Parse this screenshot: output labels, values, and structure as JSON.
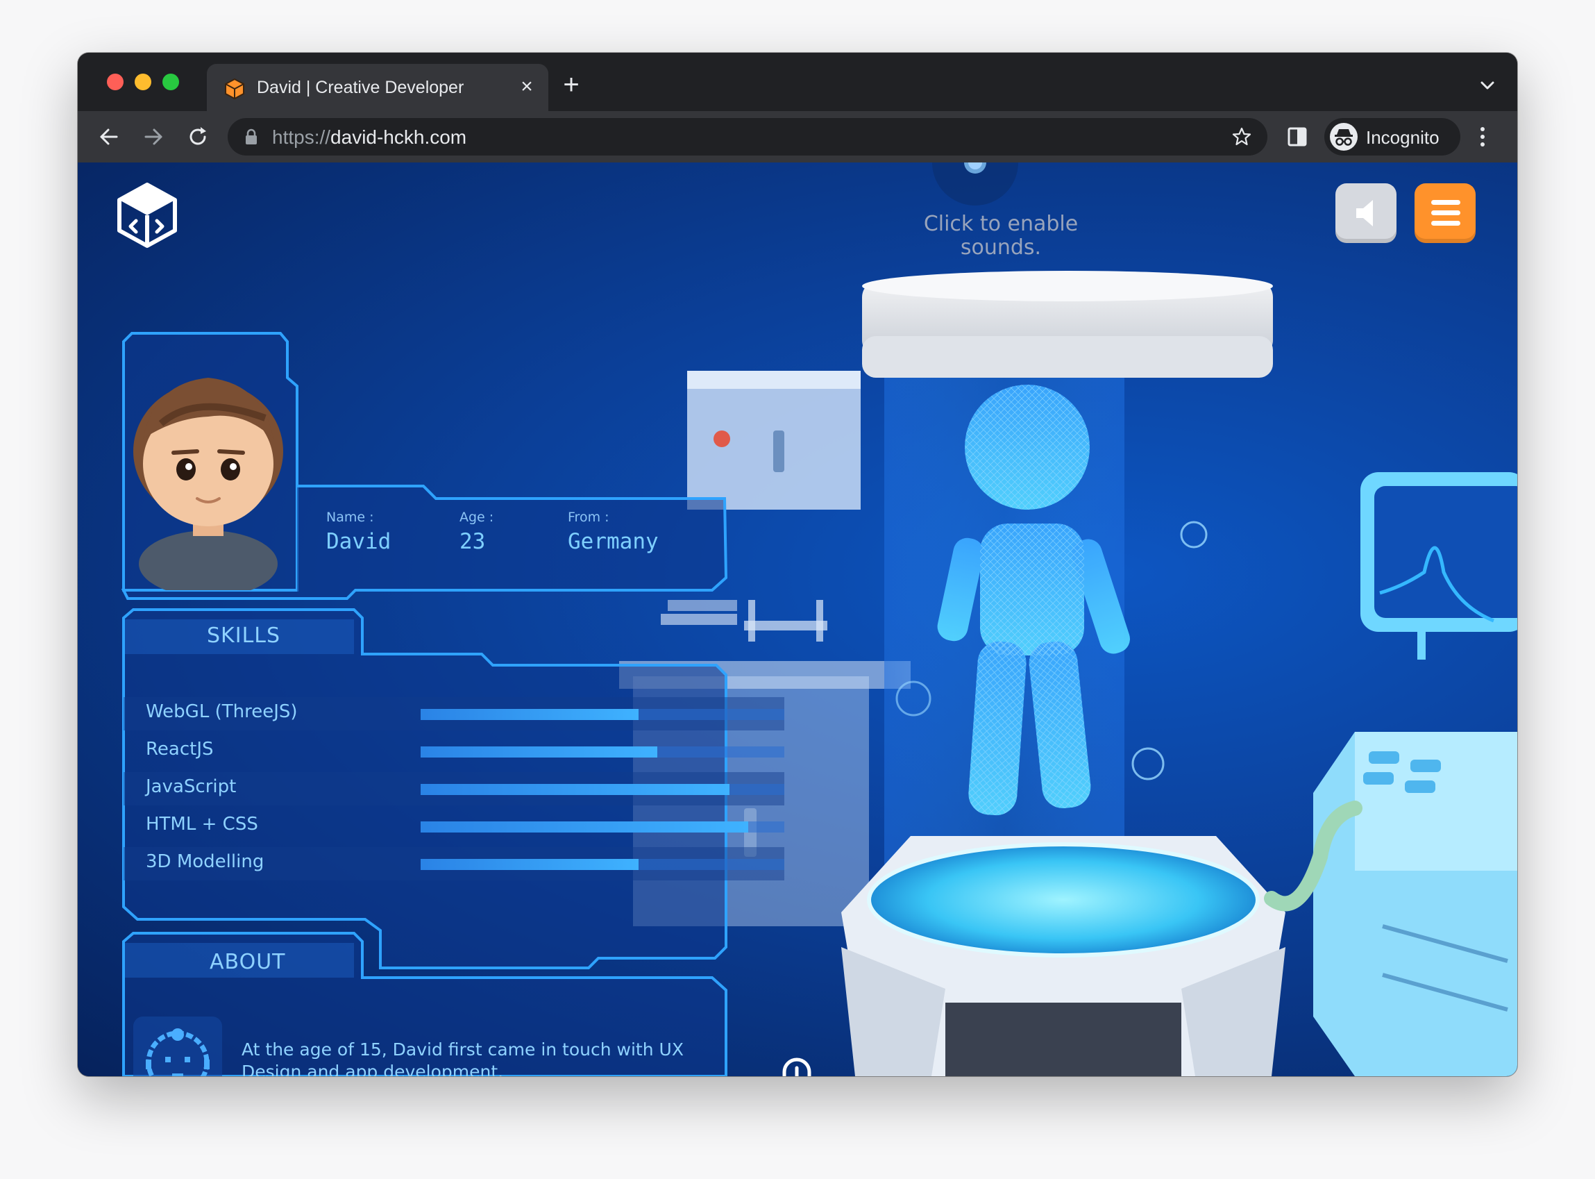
{
  "browser": {
    "tab_title": "David | Creative Developer",
    "url_scheme": "https://",
    "url_host": "david-hckh.com",
    "incognito_label": "Incognito",
    "icons": [
      "back-arrow-icon",
      "forward-arrow-icon",
      "reload-icon",
      "lock-icon",
      "star-icon",
      "side-panel-icon",
      "incognito-icon",
      "more-vert-icon",
      "close-icon",
      "plus-icon",
      "chevron-down-icon"
    ]
  },
  "site": {
    "sound_hint_line1": "Click to enable",
    "sound_hint_line2": "sounds.",
    "colors": {
      "accent": "#ff922b",
      "panel_border": "#2fa3ff",
      "text": "#8fd2ff",
      "bg": "#0b3f98"
    }
  },
  "profile": {
    "name_label": "Name :",
    "name_value": "David",
    "age_label": "Age :",
    "age_value": "23",
    "from_label": "From :",
    "from_value": "Germany"
  },
  "skills": {
    "title": "SKILLS",
    "items": [
      {
        "label": "WebGL (ThreeJS)",
        "level": 0.6
      },
      {
        "label": "ReactJS",
        "level": 0.65
      },
      {
        "label": "JavaScript",
        "level": 0.85
      },
      {
        "label": "HTML + CSS",
        "level": 0.9
      },
      {
        "label": "3D Modelling",
        "level": 0.6
      }
    ]
  },
  "about": {
    "title": "ABOUT",
    "text": "At the age of 15, David first came in touch with UX Design and app development."
  }
}
